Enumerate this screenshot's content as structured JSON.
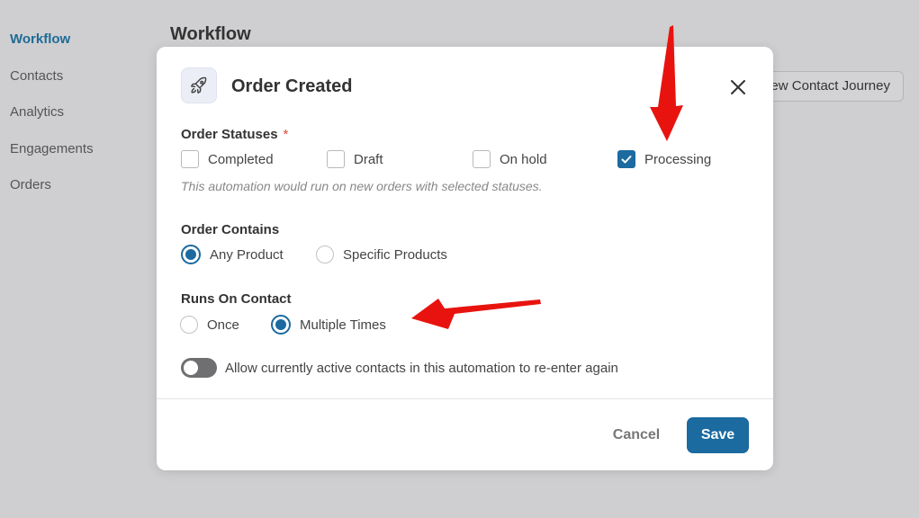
{
  "sidebar": {
    "items": [
      {
        "label": "Workflow",
        "active": true
      },
      {
        "label": "Contacts"
      },
      {
        "label": "Analytics"
      },
      {
        "label": "Engagements"
      },
      {
        "label": "Orders"
      }
    ]
  },
  "page": {
    "title": "Workflow",
    "journey_button": "View Contact Journey"
  },
  "modal": {
    "icon": "rocket-icon",
    "title": "Order Created",
    "order_statuses": {
      "label": "Order Statuses",
      "required_mark": "*",
      "options": [
        {
          "label": "Completed",
          "checked": false
        },
        {
          "label": "Draft",
          "checked": false
        },
        {
          "label": "On hold",
          "checked": false
        },
        {
          "label": "Processing",
          "checked": true
        }
      ],
      "hint": "This automation would run on new orders with selected statuses."
    },
    "order_contains": {
      "label": "Order Contains",
      "options": [
        {
          "label": "Any Product",
          "selected": true
        },
        {
          "label": "Specific Products",
          "selected": false
        }
      ]
    },
    "runs_on_contact": {
      "label": "Runs On Contact",
      "options": [
        {
          "label": "Once",
          "selected": false
        },
        {
          "label": "Multiple Times",
          "selected": true
        }
      ]
    },
    "reenter_toggle": {
      "label": "Allow currently active contacts in this automation to re-enter again",
      "on": false
    },
    "cancel_label": "Cancel",
    "save_label": "Save"
  },
  "colors": {
    "accent": "#1b6aa0",
    "annotation_arrow": "#e8130f",
    "required": "#e0463a"
  }
}
